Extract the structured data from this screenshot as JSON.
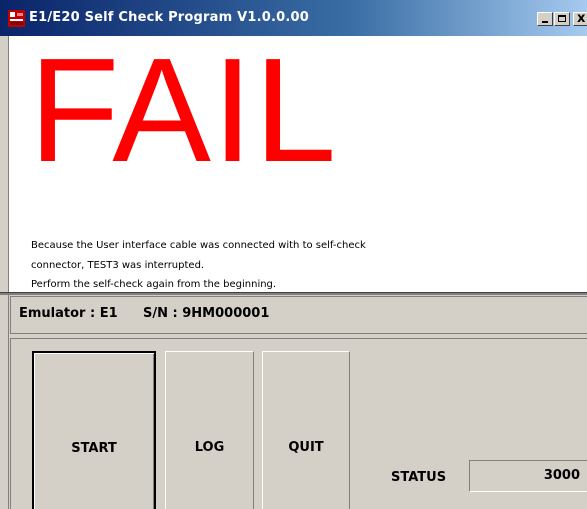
{
  "window": {
    "title": "E1/E20 Self Check Program V1.0.0.00",
    "controls": {
      "minimize": "_",
      "maximize": "□",
      "close": "x"
    },
    "app_icon": "renesas-app-icon",
    "accent_color": "#0a246a"
  },
  "result": {
    "text": "FAIL",
    "color": "#ff0000"
  },
  "message": {
    "lines": [
      "Because the User interface cable was connected with to self-check",
      "connector, TEST3 was interrupted.",
      "Perform the self-check again from the beginning."
    ]
  },
  "info": {
    "emulator": "Emulator : E1",
    "serial": "S/N : 9HM000001"
  },
  "buttons": {
    "start": "START",
    "log": "LOG",
    "quit": "QUIT"
  },
  "status": {
    "label": "STATUS",
    "value": "3000"
  }
}
